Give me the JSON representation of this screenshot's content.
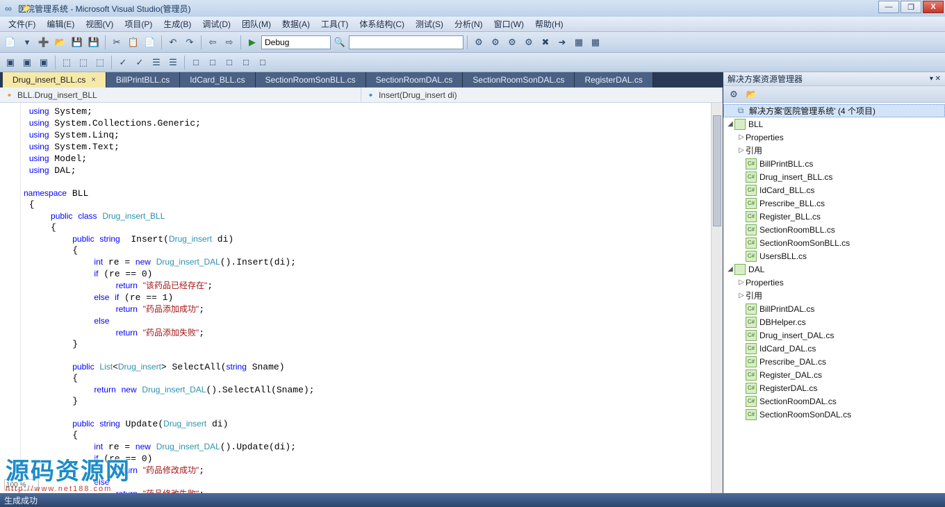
{
  "title": "医院管理系统 - Microsoft Visual Studio(管理员)",
  "winBtns": {
    "min": "—",
    "max": "❐",
    "close": "X"
  },
  "menu": [
    "文件(F)",
    "编辑(E)",
    "视图(V)",
    "项目(P)",
    "生成(B)",
    "调试(D)",
    "团队(M)",
    "数据(A)",
    "工具(T)",
    "体系结构(C)",
    "测试(S)",
    "分析(N)",
    "窗口(W)",
    "帮助(H)"
  ],
  "config": "Debug",
  "tabs": [
    {
      "label": "Drug_insert_BLL.cs",
      "active": true
    },
    {
      "label": "BillPrintBLL.cs"
    },
    {
      "label": "IdCard_BLL.cs"
    },
    {
      "label": "SectionRoomSonBLL.cs"
    },
    {
      "label": "SectionRoomDAL.cs"
    },
    {
      "label": "SectionRoomSonDAL.cs"
    },
    {
      "label": "RegisterDAL.cs"
    }
  ],
  "nav": {
    "left": "BLL.Drug_insert_BLL",
    "right": "Insert(Drug_insert di)"
  },
  "explorer": {
    "title": "解决方案资源管理器",
    "solution": "解决方案'医院管理系统' (4 个项目)",
    "projects": [
      {
        "name": "BLL",
        "expanded": true,
        "items": [
          "Properties",
          "引用",
          "BillPrintBLL.cs",
          "Drug_insert_BLL.cs",
          "IdCard_BLL.cs",
          "Prescribe_BLL.cs",
          "Register_BLL.cs",
          "SectionRoomBLL.cs",
          "SectionRoomSonBLL.cs",
          "UsersBLL.cs"
        ]
      },
      {
        "name": "DAL",
        "expanded": true,
        "items": [
          "Properties",
          "引用",
          "BillPrintDAL.cs",
          "DBHelper.cs",
          "Drug_insert_DAL.cs",
          "IdCard_DAL.cs",
          "Prescribe_DAL.cs",
          "Register_DAL.cs",
          "RegisterDAL.cs",
          "SectionRoomDAL.cs",
          "SectionRoomSonDAL.cs"
        ]
      }
    ]
  },
  "status": "生成成功",
  "zoom": "100 %",
  "watermark": {
    "text": "源码资源网",
    "url": "http://www.net188.com"
  },
  "code_html": "<span class=\"kw\">using</span> System;\n <span class=\"kw\">using</span> System.Collections.Generic;\n <span class=\"kw\">using</span> System.Linq;\n <span class=\"kw\">using</span> System.Text;\n <span class=\"kw\">using</span> Model;\n <span class=\"kw\">using</span> DAL;\n\n<span class=\"kw\">namespace</span> BLL\n {\n     <span class=\"kw\">public</span> <span class=\"kw\">class</span> <span class=\"type\">Drug_insert_BLL</span>\n     {\n         <span class=\"kw\">public</span> <span class=\"kw\">string</span>  Insert(<span class=\"type\">Drug_insert</span> di)\n         {\n             <span class=\"kw\">int</span> re = <span class=\"kw\">new</span> <span class=\"type\">Drug_insert_DAL</span>().Insert(di);\n             <span class=\"kw\">if</span> (re == 0)\n                 <span class=\"kw\">return</span> <span class=\"str\">\"该药品已经存在\"</span>;\n             <span class=\"kw\">else</span> <span class=\"kw\">if</span> (re == 1)\n                 <span class=\"kw\">return</span> <span class=\"str\">\"药品添加成功\"</span>;\n             <span class=\"kw\">else</span>\n                 <span class=\"kw\">return</span> <span class=\"str\">\"药品添加失败\"</span>;\n         }\n\n         <span class=\"kw\">public</span> <span class=\"type\">List</span>&lt;<span class=\"type\">Drug_insert</span>&gt; SelectAll(<span class=\"kw\">string</span> Sname)\n         {\n             <span class=\"kw\">return</span> <span class=\"kw\">new</span> <span class=\"type\">Drug_insert_DAL</span>().SelectAll(Sname);\n         }\n\n         <span class=\"kw\">public</span> <span class=\"kw\">string</span> Update(<span class=\"type\">Drug_insert</span> di)\n         {\n             <span class=\"kw\">int</span> re = <span class=\"kw\">new</span> <span class=\"type\">Drug_insert_DAL</span>().Update(di);\n             <span class=\"kw\">if</span> (re == 0)\n                 <span class=\"kw\">return</span> <span class=\"str\">\"药品修改成功\"</span>;\n             <span class=\"kw\">else</span>\n                 <span class=\"kw\">return</span> <span class=\"str\">\"药品修改失败\"</span>;"
}
